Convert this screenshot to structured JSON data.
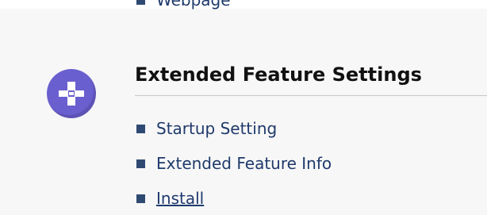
{
  "colors": {
    "bullet": "#2f4a72",
    "link_text": "#1f3a6b",
    "icon_circle": "#6a5fcf",
    "divider": "#c8c8c8"
  },
  "previous_section": {
    "items": [
      {
        "label": "Webpage",
        "icon": "square-bullet-icon"
      }
    ]
  },
  "extended_feature": {
    "icon": "puzzle-piece-icon",
    "title": "Extended Feature Settings",
    "items": [
      {
        "label": "Startup Setting",
        "icon": "square-bullet-icon"
      },
      {
        "label": "Extended Feature Info",
        "icon": "square-bullet-icon"
      },
      {
        "label": "Install",
        "icon": "square-bullet-icon"
      }
    ]
  }
}
